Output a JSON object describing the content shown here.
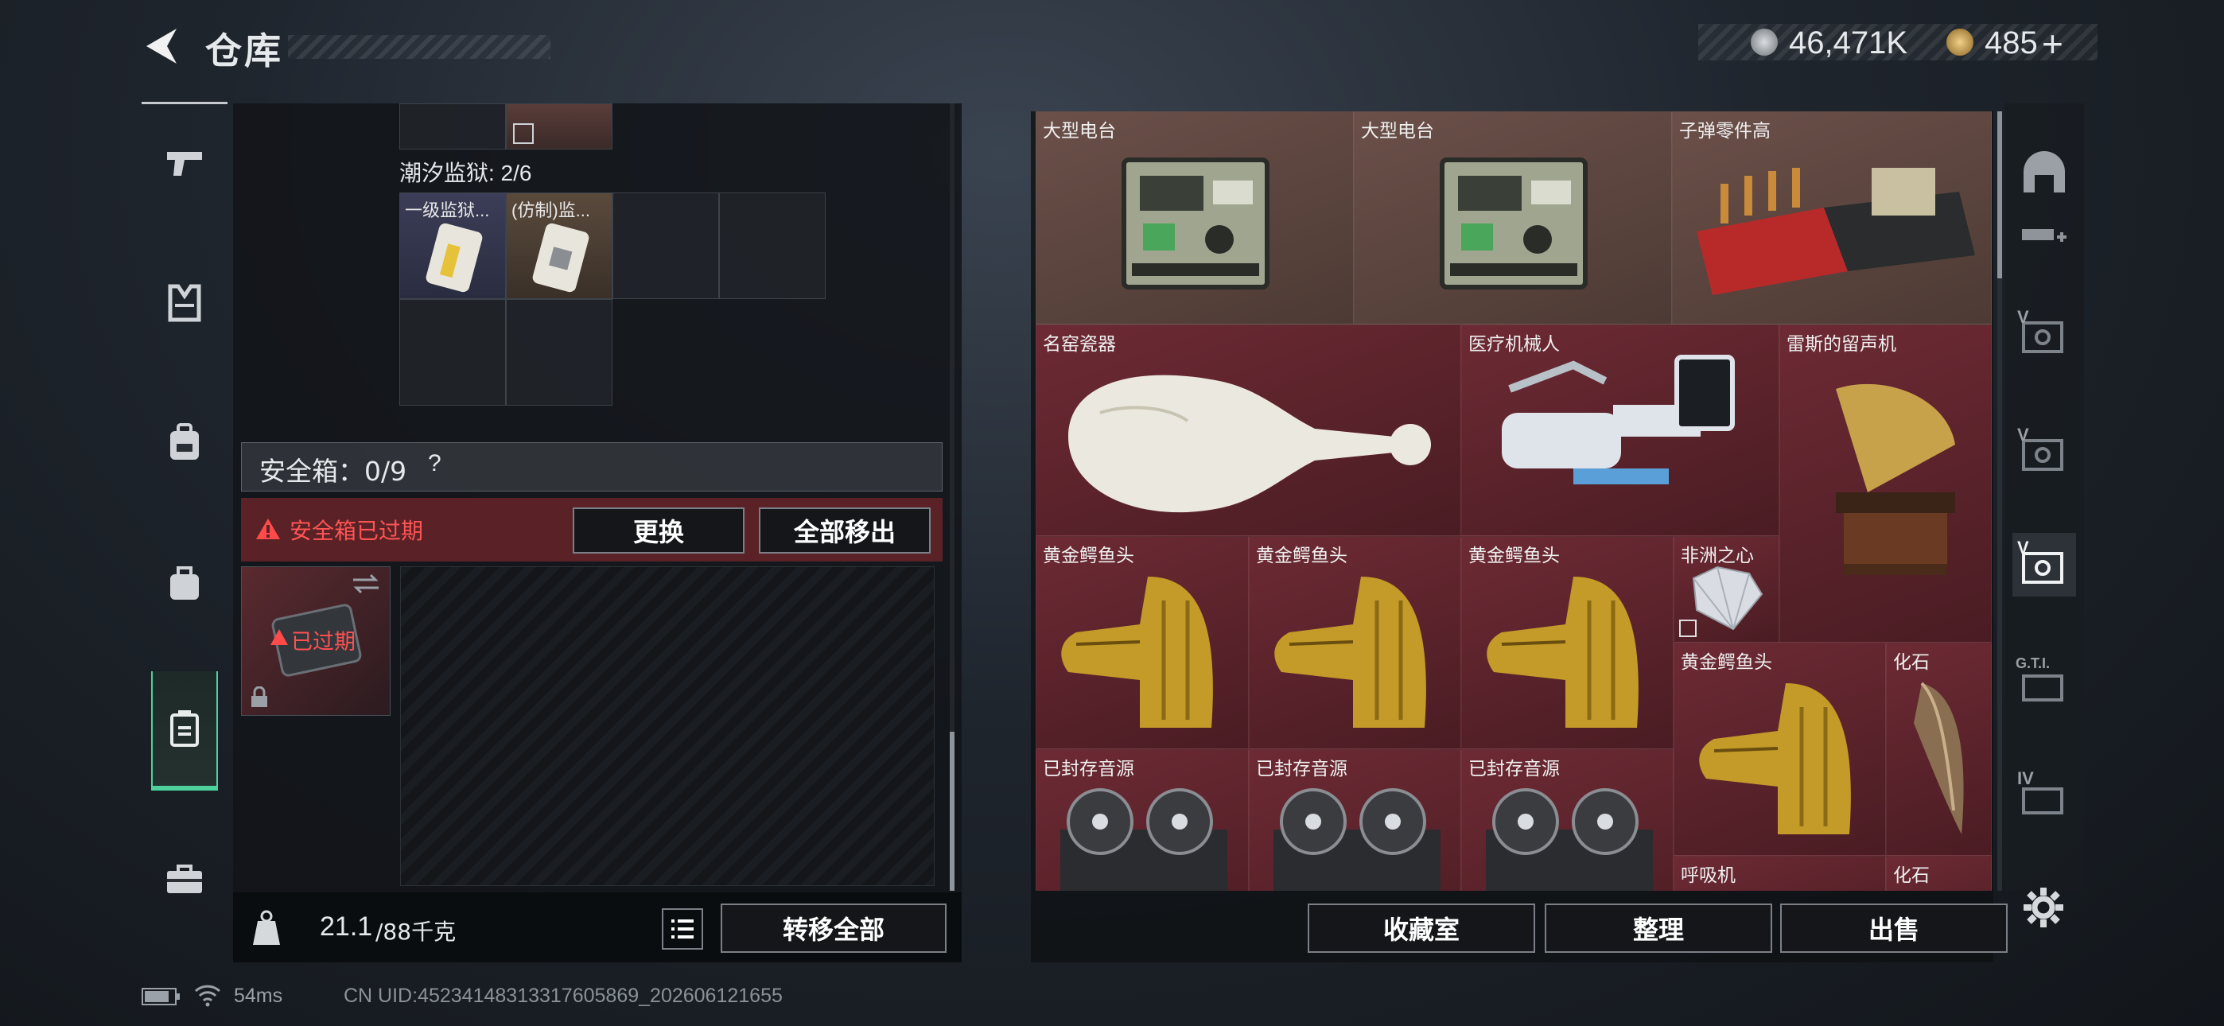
{
  "header": {
    "title": "仓库",
    "silver_amount": "46,471K",
    "gold_amount": "485",
    "add_symbol": "+"
  },
  "left_nav": {
    "items": [
      "pistol-icon",
      "armor-vest-icon",
      "backpack-icon",
      "pouch-icon",
      "safe-box-icon",
      "toolbox-icon"
    ],
    "active_index": 4
  },
  "container": {
    "prison_label": "潮汐监狱: 2/6",
    "items": [
      {
        "label": "一级监狱..."
      },
      {
        "label": "(仿制)监..."
      }
    ]
  },
  "safe_box": {
    "header": "安全箱：0/9",
    "help": "?",
    "expired_text": "安全箱已过期",
    "replace_button": "更换",
    "move_all_out_button": "全部移出",
    "case_status": "已过期"
  },
  "bottom_left": {
    "weight_current": "21.1",
    "weight_max": "/88千克",
    "transfer_all_button": "转移全部"
  },
  "collection": {
    "items": [
      {
        "label": "大型电台",
        "kind": "radio-icon",
        "color": "brown"
      },
      {
        "label": "大型电台",
        "kind": "radio-icon",
        "color": "brown"
      },
      {
        "label": "子弹零件高",
        "kind": "ammo-crate-icon",
        "color": "brown"
      },
      {
        "label": "名窑瓷器",
        "kind": "porcelain-vase-icon",
        "color": "red"
      },
      {
        "label": "医疗机械人",
        "kind": "medical-robot-icon",
        "color": "red"
      },
      {
        "label": "雷斯的留声机",
        "kind": "gramophone-icon",
        "color": "red"
      },
      {
        "label": "黄金鳄鱼头",
        "kind": "gold-crocodile-head-icon",
        "color": "red"
      },
      {
        "label": "黄金鳄鱼头",
        "kind": "gold-crocodile-head-icon",
        "color": "red"
      },
      {
        "label": "黄金鳄鱼头",
        "kind": "gold-crocodile-head-icon",
        "color": "red"
      },
      {
        "label": "非洲之心",
        "kind": "diamond-icon",
        "color": "red"
      },
      {
        "label": "黄金鳄鱼头",
        "kind": "gold-crocodile-head-icon",
        "color": "red"
      },
      {
        "label": "化石",
        "kind": "fossil-tooth-icon",
        "color": "red"
      },
      {
        "label": "已封存音源",
        "kind": "reel-recorder-icon",
        "color": "red"
      },
      {
        "label": "已封存音源",
        "kind": "reel-recorder-icon",
        "color": "red"
      },
      {
        "label": "已封存音源",
        "kind": "reel-recorder-icon",
        "color": "red"
      },
      {
        "label": "呼吸机",
        "kind": "respirator-icon",
        "color": "red"
      },
      {
        "label": "化石",
        "kind": "fossil-icon",
        "color": "red"
      }
    ],
    "buttons": {
      "collection_room": "收藏室",
      "organize": "整理",
      "sell": "出售"
    }
  },
  "right_nav": {
    "items": [
      "vault-icon",
      "gun-add-icon",
      "v-tier-icon",
      "v-tier-icon",
      "v-tier-icon",
      "gti-icon",
      "iv-tier-icon"
    ],
    "labels": [
      "V",
      "V",
      "V",
      "G.T.I.",
      "IV"
    ]
  },
  "footer": {
    "ping": "54ms",
    "uid": "CN UID:4523414831331760586​9_202606121655"
  }
}
